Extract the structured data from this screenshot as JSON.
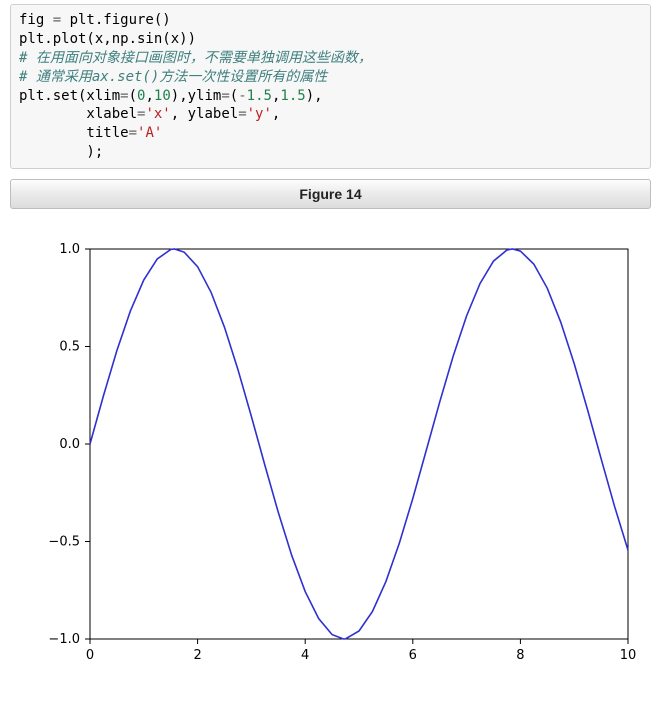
{
  "code": {
    "line1_a": "fig ",
    "line1_eq": "= ",
    "line1_b": "plt.figure()",
    "line2_a": "plt.plot(x,np.sin(x))",
    "line3_comment": "# 在用面向对象接口画图时，不需要单独调用这些函数，",
    "line4_comment": "# 通常采用ax.set()方法一次性设置所有的属性",
    "line5_a": "plt.set(xlim",
    "line5_eq1": "=",
    "line5_p1": "(",
    "line5_n0": "0",
    "line5_c1": ",",
    "line5_n10": "10",
    "line5_p2": "),ylim",
    "line5_eq2": "=",
    "line5_p3": "(",
    "line5_neg": "-",
    "line5_n15a": "1.5",
    "line5_c2": ",",
    "line5_n15b": "1.5",
    "line5_p4": "),",
    "line6_a": "        xlabel",
    "line6_eq": "=",
    "line6_s1": "'x'",
    "line6_c": ", ylabel",
    "line6_eq2": "=",
    "line6_s2": "'y'",
    "line6_end": ",",
    "line7_a": "        title",
    "line7_eq": "=",
    "line7_s": "'A'",
    "line8": "        );"
  },
  "figure_header": "Figure 14",
  "chart_data": {
    "type": "line",
    "title": "",
    "xlabel": "",
    "ylabel": "",
    "xlim": [
      0,
      10
    ],
    "ylim": [
      -1.0,
      1.0
    ],
    "x_ticks": [
      0,
      2,
      4,
      6,
      8,
      10
    ],
    "y_ticks": [
      -1.0,
      -0.5,
      0.0,
      0.5,
      1.0
    ],
    "y_tick_labels": [
      "−1.0",
      "−0.5",
      "0.0",
      "0.5",
      "1.0"
    ],
    "series": [
      {
        "name": "sin(x)",
        "color": "#3030d0",
        "x": [
          0.0,
          0.25,
          0.5,
          0.75,
          1.0,
          1.25,
          1.5,
          1.5708,
          1.75,
          2.0,
          2.25,
          2.5,
          2.75,
          3.0,
          3.1416,
          3.25,
          3.5,
          3.75,
          4.0,
          4.25,
          4.5,
          4.7124,
          4.75,
          5.0,
          5.25,
          5.5,
          5.75,
          6.0,
          6.2832,
          6.5,
          6.75,
          7.0,
          7.25,
          7.5,
          7.75,
          7.854,
          8.0,
          8.25,
          8.5,
          8.75,
          9.0,
          9.25,
          9.4248,
          9.5,
          9.75,
          10.0
        ],
        "y": [
          0.0,
          0.2474,
          0.4794,
          0.6816,
          0.8415,
          0.949,
          0.9975,
          1.0,
          0.9839,
          0.9093,
          0.7781,
          0.5985,
          0.3817,
          0.1411,
          0.0,
          -0.1082,
          -0.3508,
          -0.5716,
          -0.7568,
          -0.895,
          -0.9775,
          -1.0,
          -0.9993,
          -0.9589,
          -0.8589,
          -0.7055,
          -0.5083,
          -0.2794,
          0.0,
          0.2151,
          0.45,
          0.657,
          0.8231,
          0.938,
          0.9946,
          1.0,
          0.9894,
          0.9224,
          0.7985,
          0.6248,
          0.4121,
          0.1736,
          0.0,
          -0.0752,
          -0.3195,
          -0.544
        ]
      }
    ]
  }
}
